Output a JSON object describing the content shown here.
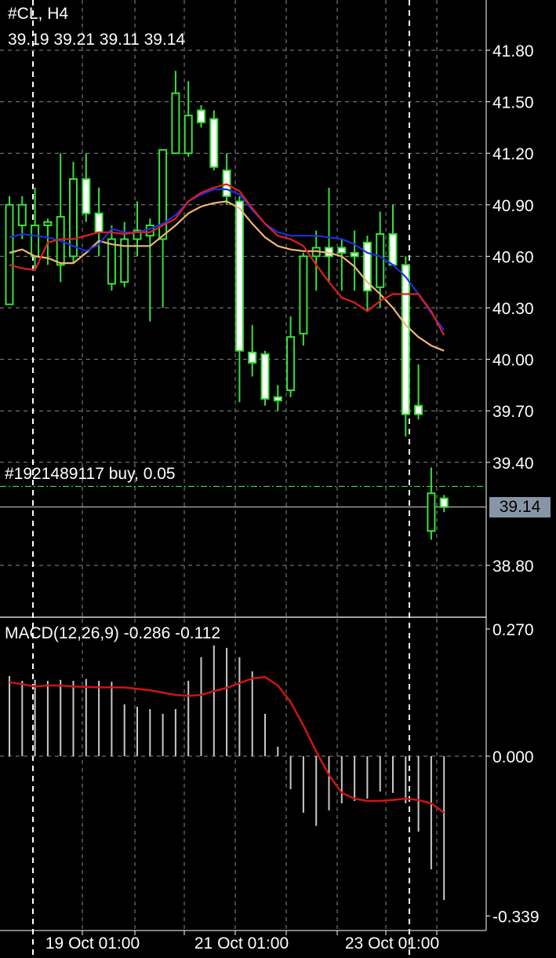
{
  "header": {
    "symbol": "#CL, H4",
    "ohlc": "39.19 39.21 39.11 39.14"
  },
  "order_line": {
    "label": "#1921489117 buy, 0.05",
    "price": 39.26
  },
  "current_price": "39.14",
  "colors": {
    "background": "#000000",
    "grid": "#8a8a8a",
    "candle": "#36e03a",
    "ma_fast": "#e01e1e",
    "ma_mid": "#1e2ee0",
    "ma_slow": "#f0b470",
    "macd_hist": "#c8c8c8",
    "macd_signal": "#d01414",
    "order_line": "#36e03a",
    "bid_line": "#b0b0b0",
    "price_tag_bg": "#8796a6"
  },
  "chart_data": [
    {
      "type": "candlestick",
      "title": "#CL, H4",
      "y_ticks": [
        "41.80",
        "41.50",
        "41.20",
        "40.90",
        "40.60",
        "40.30",
        "40.00",
        "39.70",
        "39.40",
        "38.80"
      ],
      "ylim": [
        38.64,
        41.99
      ],
      "x_ticks": [
        "19 Oct 01:00",
        "21 Oct 01:00",
        "23 Oct 01:00"
      ],
      "session_breaks": [
        2,
        32
      ],
      "grid": true,
      "candles": [
        {
          "o": 40.32,
          "h": 40.95,
          "l": 40.32,
          "c": 40.9
        },
        {
          "o": 40.78,
          "h": 40.95,
          "l": 40.7,
          "c": 40.9
        },
        {
          "o": 40.6,
          "h": 41.0,
          "l": 40.52,
          "c": 40.78
        },
        {
          "o": 40.78,
          "h": 40.82,
          "l": 40.55,
          "c": 40.8
        },
        {
          "o": 40.55,
          "h": 41.2,
          "l": 40.45,
          "c": 40.83
        },
        {
          "o": 40.6,
          "h": 41.15,
          "l": 40.56,
          "c": 41.05
        },
        {
          "o": 41.05,
          "h": 41.2,
          "l": 40.8,
          "c": 40.85
        },
        {
          "o": 40.85,
          "h": 41.0,
          "l": 40.6,
          "c": 40.74
        },
        {
          "o": 40.44,
          "h": 40.78,
          "l": 40.4,
          "c": 40.7
        },
        {
          "o": 40.45,
          "h": 40.8,
          "l": 40.42,
          "c": 40.7
        },
        {
          "o": 40.7,
          "h": 40.92,
          "l": 40.6,
          "c": 40.75
        },
        {
          "o": 40.72,
          "h": 40.82,
          "l": 40.22,
          "c": 40.78
        },
        {
          "o": 40.7,
          "h": 41.05,
          "l": 40.3,
          "c": 41.22
        },
        {
          "o": 41.2,
          "h": 41.68,
          "l": 41.2,
          "c": 41.55
        },
        {
          "o": 41.2,
          "h": 41.62,
          "l": 41.18,
          "c": 41.42
        },
        {
          "o": 41.45,
          "h": 41.48,
          "l": 41.35,
          "c": 41.38
        },
        {
          "o": 41.4,
          "h": 41.45,
          "l": 41.1,
          "c": 41.12
        },
        {
          "o": 41.1,
          "h": 41.2,
          "l": 40.9,
          "c": 40.95
        },
        {
          "o": 40.92,
          "h": 40.95,
          "l": 39.75,
          "c": 40.05
        },
        {
          "o": 40.04,
          "h": 40.2,
          "l": 39.9,
          "c": 39.98
        },
        {
          "o": 40.03,
          "h": 40.05,
          "l": 39.73,
          "c": 39.77
        },
        {
          "o": 39.78,
          "h": 39.85,
          "l": 39.7,
          "c": 39.76
        },
        {
          "o": 39.82,
          "h": 40.25,
          "l": 39.78,
          "c": 40.13
        },
        {
          "o": 40.15,
          "h": 40.62,
          "l": 40.08,
          "c": 40.6
        },
        {
          "o": 40.6,
          "h": 40.75,
          "l": 40.4,
          "c": 40.65
        },
        {
          "o": 40.65,
          "h": 41.0,
          "l": 40.45,
          "c": 40.6
        },
        {
          "o": 40.65,
          "h": 40.7,
          "l": 40.4,
          "c": 40.62
        },
        {
          "o": 40.62,
          "h": 40.75,
          "l": 40.4,
          "c": 40.6
        },
        {
          "o": 40.68,
          "h": 40.72,
          "l": 40.28,
          "c": 40.4
        },
        {
          "o": 40.42,
          "h": 40.86,
          "l": 40.3,
          "c": 40.73
        },
        {
          "o": 40.73,
          "h": 40.9,
          "l": 40.55,
          "c": 40.55
        },
        {
          "o": 40.55,
          "h": 40.6,
          "l": 39.55,
          "c": 39.68
        },
        {
          "o": 39.73,
          "h": 39.97,
          "l": 39.65,
          "c": 39.68
        },
        {
          "o": 39.0,
          "h": 39.37,
          "l": 38.95,
          "c": 39.22
        },
        {
          "o": 39.19,
          "h": 39.21,
          "l": 39.11,
          "c": 39.14
        }
      ],
      "moving_averages": [
        {
          "color": "ma_fast",
          "values": [
            40.55,
            40.53,
            40.52,
            40.68,
            40.7,
            40.7,
            40.72,
            40.74,
            40.74,
            40.73,
            40.74,
            40.74,
            40.78,
            40.82,
            40.92,
            40.97,
            41.0,
            41.02,
            40.98,
            40.88,
            40.79,
            40.72,
            40.7,
            40.66,
            40.55,
            40.45,
            40.36,
            40.33,
            40.28,
            40.34,
            40.38,
            40.38,
            40.38,
            40.28,
            40.14
          ]
        },
        {
          "color": "ma_mid",
          "values": [
            40.71,
            40.73,
            40.72,
            40.71,
            40.69,
            40.66,
            40.63,
            40.67,
            40.76,
            40.74,
            40.74,
            40.76,
            40.79,
            40.84,
            40.92,
            40.96,
            40.99,
            40.99,
            40.96,
            40.87,
            40.79,
            40.74,
            40.72,
            40.72,
            40.72,
            40.71,
            40.7,
            40.67,
            40.62,
            40.6,
            40.55,
            40.48,
            40.38,
            40.27,
            40.17
          ]
        },
        {
          "color": "ma_slow",
          "values": [
            40.62,
            40.64,
            40.6,
            40.59,
            40.56,
            40.56,
            40.62,
            40.69,
            40.67,
            40.66,
            40.66,
            40.66,
            40.72,
            40.78,
            40.85,
            40.89,
            40.91,
            40.92,
            40.88,
            40.79,
            40.71,
            40.66,
            40.64,
            40.63,
            40.63,
            40.62,
            40.6,
            40.54,
            40.45,
            40.38,
            40.3,
            40.2,
            40.13,
            40.08,
            40.05
          ]
        }
      ]
    },
    {
      "type": "macd",
      "title": "MACD(12,26,9) -0.286 -0.112",
      "y_ticks": [
        "0.270",
        "0.000",
        "-0.339"
      ],
      "ylim": [
        -0.339,
        0.27
      ],
      "histogram": [
        0.17,
        0.16,
        0.162,
        0.16,
        0.162,
        0.16,
        0.164,
        0.16,
        0.158,
        0.11,
        0.105,
        0.1,
        0.09,
        0.1,
        0.16,
        0.21,
        0.235,
        0.23,
        0.21,
        0.18,
        0.09,
        0.02,
        -0.07,
        -0.12,
        -0.148,
        -0.115,
        -0.1,
        -0.095,
        -0.09,
        -0.075,
        -0.078,
        -0.1,
        -0.16,
        -0.24,
        -0.305
      ],
      "signal": [
        0.157,
        0.153,
        0.148,
        0.15,
        0.15,
        0.148,
        0.147,
        0.146,
        0.146,
        0.146,
        0.143,
        0.14,
        0.135,
        0.13,
        0.128,
        0.13,
        0.138,
        0.145,
        0.155,
        0.165,
        0.168,
        0.15,
        0.115,
        0.065,
        0.01,
        -0.04,
        -0.078,
        -0.09,
        -0.095,
        -0.095,
        -0.093,
        -0.09,
        -0.093,
        -0.1,
        -0.12
      ]
    }
  ]
}
